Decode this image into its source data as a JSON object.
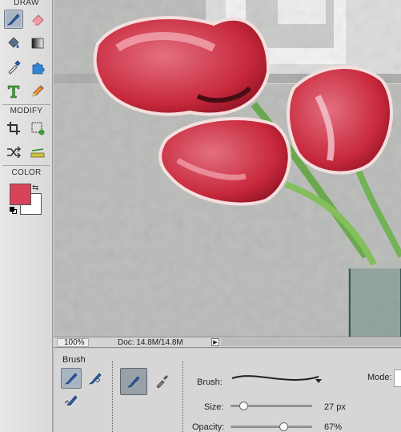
{
  "toolbox": {
    "draw_label": "DRAW",
    "modify_label": "MODIFY",
    "color_label": "COLOR",
    "draw_tools": [
      "brush-tool",
      "eraser-tool",
      "paint-bucket-tool",
      "gradient-tool",
      "eyedropper-tool",
      "custom-shape-tool",
      "type-tool",
      "pencil-tool"
    ],
    "modify_tools": [
      "crop-tool",
      "recompose-tool",
      "content-aware-move-tool",
      "straighten-tool"
    ],
    "foreground_color": "#d9435a",
    "background_color": "#ffffff"
  },
  "status": {
    "zoom": "100%",
    "doc_info": "Doc: 14.8M/14.8M"
  },
  "options": {
    "title": "Brush",
    "brush_label": "Brush:",
    "mode_label": "Mode:",
    "size_label": "Size:",
    "size_value": "27 px",
    "size_level": 0.12,
    "opacity_label": "Opacity:",
    "opacity_value": "67%",
    "opacity_level": 0.67
  }
}
